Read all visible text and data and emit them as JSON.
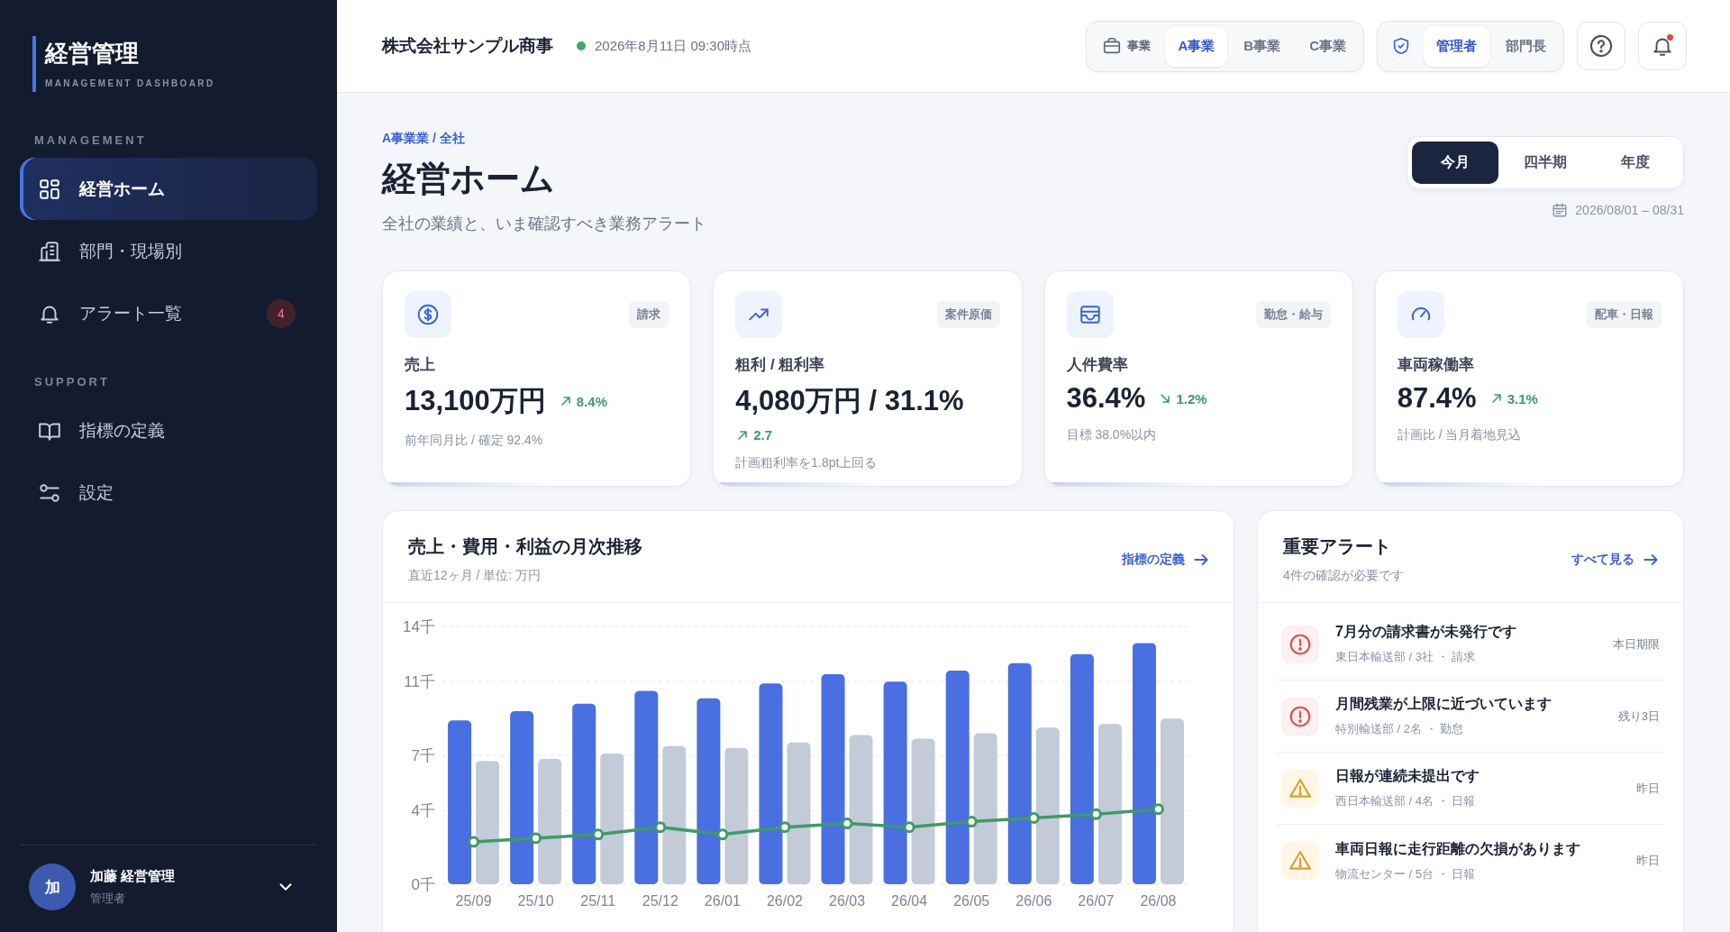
{
  "sidebar": {
    "brand": {
      "title": "経営管理",
      "subtitle": "MANAGEMENT DASHBOARD"
    },
    "sections": [
      {
        "heading": "MANAGEMENT",
        "items": [
          {
            "label": "経営ホーム",
            "selected": true
          },
          {
            "label": "部門・現場別",
            "selected": false
          },
          {
            "label": "アラート一覧",
            "selected": false,
            "badge": "4"
          }
        ]
      },
      {
        "heading": "SUPPORT",
        "items": [
          {
            "label": "指標の定義",
            "selected": false
          },
          {
            "label": "設定",
            "selected": false
          }
        ]
      }
    ],
    "user": {
      "avatar": "加",
      "name": "加藤 経営管理",
      "role": "管理者"
    }
  },
  "header": {
    "company": "株式会社サンプル商事",
    "updated_at": "2026年8月11日 09:30時点",
    "business_switch": {
      "label": "事業",
      "options": [
        {
          "label": "A事業",
          "selected": true
        },
        {
          "label": "B事業",
          "selected": false
        },
        {
          "label": "C事業",
          "selected": false
        }
      ]
    },
    "role_switch": {
      "options": [
        {
          "label": "管理者",
          "selected": true
        },
        {
          "label": "部門長",
          "selected": false
        }
      ]
    },
    "notifications": {
      "unread": true
    }
  },
  "page": {
    "breadcrumb": "A事業業 / 全社",
    "title": "経営ホーム",
    "subtitle": "全社の業績と、いま確認すべき業務アラート",
    "periods": [
      {
        "label": "今月",
        "selected": true
      },
      {
        "label": "四半期",
        "selected": false
      },
      {
        "label": "年度",
        "selected": false
      }
    ],
    "date_range": "2026/08/01 – 08/31"
  },
  "kpis": [
    {
      "label": "売上",
      "tag": "請求",
      "value": "13,100万円",
      "delta": "8.4%",
      "kind": "up",
      "note": "前年同月比 / 確定 92.4%"
    },
    {
      "label": "粗利 / 粗利率",
      "tag": "案件原価",
      "value": "4,080万円 / 31.1%",
      "delta": "2.7",
      "kind": "up",
      "note": "計画粗利率を1.8pt上回る"
    },
    {
      "label": "人件費率",
      "tag": "勤怠・給与",
      "value": "36.4%",
      "delta": "1.2%",
      "kind": "down",
      "note": "目標 38.0%以内"
    },
    {
      "label": "車両稼働率",
      "tag": "配車・日報",
      "value": "87.4%",
      "delta": "3.1%",
      "kind": "up",
      "note": "計画比 / 当月着地見込"
    }
  ],
  "chart_panel": {
    "title": "売上・費用・利益の月次推移",
    "subtitle": "直近12ヶ月 / 単位: 万円",
    "link": "指標の定義",
    "chart_data": {
      "type": "bar",
      "categories": [
        "25/09",
        "25/10",
        "25/11",
        "25/12",
        "26/01",
        "26/02",
        "26/03",
        "26/04",
        "26/05",
        "26/06",
        "26/07",
        "26/08"
      ],
      "series": [
        {
          "type": "bar",
          "color": "#4a6fe0",
          "values": [
            8.9,
            9.4,
            9.8,
            10.5,
            10.1,
            10.9,
            11.4,
            11.0,
            11.6,
            12.0,
            12.5,
            13.1
          ]
        },
        {
          "type": "bar",
          "color": "#c3cbd9",
          "values": [
            6.7,
            6.8,
            7.1,
            7.5,
            7.4,
            7.7,
            8.1,
            7.9,
            8.2,
            8.5,
            8.7,
            9.0
          ]
        },
        {
          "type": "line",
          "color": "#3f9a66",
          "marker": true,
          "values": [
            2.3,
            2.5,
            2.7,
            3.1,
            2.7,
            3.1,
            3.3,
            3.1,
            3.4,
            3.6,
            3.8,
            4.08
          ]
        }
      ],
      "stacked": false,
      "grid": true,
      "ylim": [
        0,
        14
      ],
      "yticks": [
        {
          "value": 0,
          "label": "0千"
        },
        {
          "value": 4,
          "label": "4千"
        },
        {
          "value": 7,
          "label": "7千"
        },
        {
          "value": 11,
          "label": "11千"
        },
        {
          "value": 14,
          "label": "14千"
        }
      ]
    }
  },
  "alerts": {
    "title": "重要アラート",
    "subtitle": "4件の確認が必要です",
    "link": "すべて見る",
    "items": [
      {
        "kind": "error",
        "title": "7月分の請求書が未発行です",
        "meta": "東日本輸送部 / 3社 ・ 請求",
        "due": "本日期限"
      },
      {
        "kind": "error",
        "title": "月間残業が上限に近づいています",
        "meta": "特別輸送部 / 2名 ・ 勤怠",
        "due": "残り3日"
      },
      {
        "kind": "warning",
        "title": "日報が連続未提出です",
        "meta": "西日本輸送部 / 4名 ・ 日報",
        "due": "昨日"
      },
      {
        "kind": "warning",
        "title": "車両日報に走行距離の欠損があります",
        "meta": "物流センター / 5台 ・ 日報",
        "due": "昨日"
      }
    ]
  }
}
